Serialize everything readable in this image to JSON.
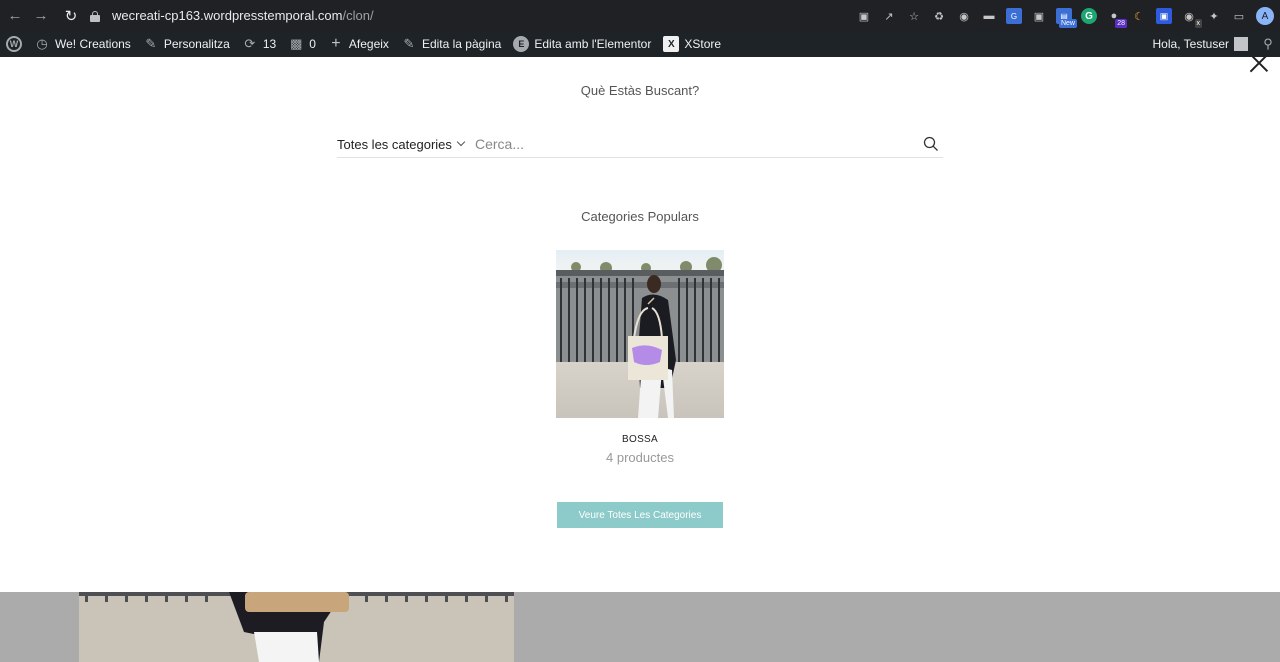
{
  "browser": {
    "url_host": "wecreati-cp163.wordpresstemporal.com",
    "url_path": "/clon/",
    "extensions": [
      {
        "icon": "translate-icon"
      },
      {
        "icon": "share-icon"
      },
      {
        "icon": "star-icon"
      },
      {
        "icon": "recycle-icon"
      },
      {
        "icon": "globe-icon"
      },
      {
        "icon": "extension-dark-icon"
      },
      {
        "icon": "translate-blue-icon"
      },
      {
        "icon": "camera-icon"
      },
      {
        "icon": "new-extension-icon",
        "badge": "New"
      },
      {
        "icon": "grammarly-icon",
        "label": "G"
      },
      {
        "icon": "calendar-extension-icon",
        "badge": "28"
      },
      {
        "icon": "moon-icon"
      },
      {
        "icon": "screen-capture-icon"
      },
      {
        "icon": "eye-extension-icon",
        "badge": "x"
      },
      {
        "icon": "puzzle-icon"
      },
      {
        "icon": "sidepanel-icon"
      }
    ],
    "profile_initial": "A"
  },
  "admin_bar": {
    "site_name": "We! Creations",
    "customize": "Personalitza",
    "updates_count": "13",
    "comments_count": "0",
    "add_new": "Afegeix",
    "edit_page": "Edita la pàgina",
    "edit_elementor": "Edita amb l'Elementor",
    "xstore": "XStore",
    "greeting": "Hola, Testuser"
  },
  "search_panel": {
    "title": "Què Estàs Buscant?",
    "category_select": "Totes les categories",
    "search_placeholder": "Cerca...",
    "popular_title": "Categories Populars",
    "categories": [
      {
        "name": "BOSSA",
        "count": "4 productes"
      }
    ],
    "view_all_label": "Veure Totes Les Categories"
  },
  "colors": {
    "accent": "#8ccbc9",
    "admin_bar_bg": "#1d2327",
    "browser_bg": "#202124",
    "bag_print": "#b58be8"
  }
}
